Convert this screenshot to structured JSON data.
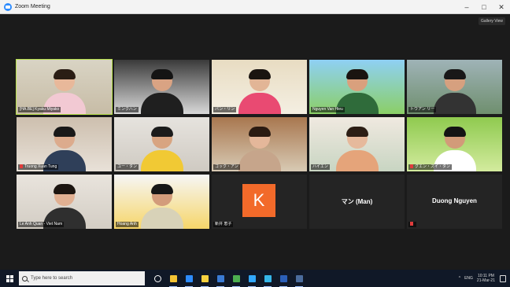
{
  "window": {
    "title": "Zoom Meeting",
    "controls": {
      "minimize": "–",
      "maximize": "□",
      "close": "✕"
    }
  },
  "meeting": {
    "view_button": "Gallery View",
    "participants": [
      {
        "name": "[HA.BE] Kyaku Miyako",
        "active": true,
        "skin": "#e8b89a",
        "hair": "#2a1d14",
        "shirt": "#f2c9d3",
        "bg1": "#d9d4c4",
        "bg2": "#c7bca6",
        "muted": false
      },
      {
        "name": "ミンクハン",
        "active": false,
        "skin": "#d9a383",
        "hair": "#141414",
        "shirt": "#1f1f1f",
        "bg1": "#3a3a3a",
        "bg2": "#d9d9d9",
        "muted": false
      },
      {
        "name": "バン・リン",
        "active": false,
        "skin": "#e2b596",
        "hair": "#1a1410",
        "shirt": "#e94a72",
        "bg1": "#e8dcc2",
        "bg2": "#f4efe2",
        "muted": false
      },
      {
        "name": "Nguyen Van Hieu",
        "active": false,
        "skin": "#d9a07d",
        "hair": "#1a1410",
        "shirt": "#2f6b3a",
        "bg1": "#8fd0f4",
        "bg2": "#8bcf66",
        "muted": false
      },
      {
        "name": "トウアン リー",
        "active": false,
        "skin": "#d6a07f",
        "hair": "#181818",
        "shirt": "#333333",
        "bg1": "#9fb3b7",
        "bg2": "#6f8f6e",
        "muted": false
      },
      {
        "name": "Truong Xuan Tung",
        "active": false,
        "skin": "#dcab8d",
        "hair": "#191919",
        "shirt": "#2f3f59",
        "bg1": "#cdbfae",
        "bg2": "#e8e1d8",
        "muted": true
      },
      {
        "name": "ユー・タン",
        "active": false,
        "skin": "#d8a481",
        "hair": "#1b1b1b",
        "shirt": "#f1c934",
        "bg1": "#e6e3de",
        "bg2": "#cfcac2",
        "muted": false
      },
      {
        "name": "ゴック・アン",
        "active": false,
        "skin": "#e4b79a",
        "hair": "#2b1b12",
        "shirt": "#c6a58b",
        "bg1": "#a8774f",
        "bg2": "#d8cab4",
        "muted": false
      },
      {
        "name": "ハイエン",
        "active": false,
        "skin": "#e6b99c",
        "hair": "#2c1e15",
        "shirt": "#e5a47a",
        "bg1": "#f0e9e0",
        "bg2": "#c8d5c2",
        "muted": false
      },
      {
        "name": "グエン・ズイ・タン",
        "active": false,
        "skin": "#d29b79",
        "hair": "#141414",
        "shirt": "#ffffff",
        "bg1": "#8fca4f",
        "bg2": "#d3eb9e",
        "muted": true
      },
      {
        "name": "Le Anh Quan - Viet Nam",
        "active": false,
        "skin": "#e1b092",
        "hair": "#1c1510",
        "shirt": "#2f2f2f",
        "bg1": "#e9e4dd",
        "bg2": "#d3cdc4",
        "muted": false
      },
      {
        "name": "Hoang Anh",
        "active": false,
        "skin": "#d39c7b",
        "hair": "#161616",
        "shirt": "#d8d2b8",
        "bg1": "#f6f6f6",
        "bg2": "#f6d66a",
        "muted": false
      },
      {
        "name": "新井 恵子",
        "active": false,
        "letter": "K",
        "muted": false
      },
      {
        "name": "",
        "active": false,
        "big_name": "マン (Man)",
        "muted": false
      },
      {
        "name": "",
        "active": false,
        "big_name": "Duong Nguyen",
        "muted": true
      }
    ]
  },
  "taskbar": {
    "search_placeholder": "Type here to search",
    "apps": [
      {
        "icon": "task-view-icon",
        "color": "#ffffff"
      },
      {
        "icon": "file-explorer-icon",
        "color": "#f3c334"
      },
      {
        "icon": "zoom-app-icon",
        "color": "#2d8cff"
      },
      {
        "icon": "sticky-notes-icon",
        "color": "#f4d03f"
      },
      {
        "icon": "store-icon",
        "color": "#3a7bd5"
      },
      {
        "icon": "chrome-icon",
        "color": "#4caf50"
      },
      {
        "icon": "photoshop-icon",
        "color": "#31a8ff"
      },
      {
        "icon": "edge-icon",
        "color": "#35b6e8"
      },
      {
        "icon": "word-icon",
        "color": "#2b5fb8"
      },
      {
        "icon": "active-window-icon",
        "color": "#4b6c9c"
      }
    ],
    "tray": {
      "lang": "ENG",
      "time": "10:11 PM",
      "date": "21-Mar-21"
    }
  }
}
